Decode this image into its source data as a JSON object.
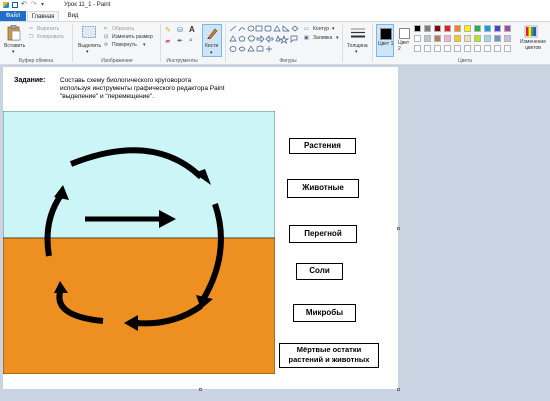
{
  "window": {
    "title": "Урок 11_1 - Paint"
  },
  "tabs": {
    "file": "Файл",
    "home": "Главная",
    "view": "Вид"
  },
  "clipboard": {
    "paste": "Вставить",
    "cut": "Вырезать",
    "copy": "Копировать",
    "label": "Буфер обмена"
  },
  "image": {
    "select": "Выделить",
    "crop": "Обрезать",
    "resize": "Изменить размер",
    "rotate": "Повернуть",
    "label": "Изображение"
  },
  "tools": {
    "label": "Инструменты",
    "brushes": "Кисти"
  },
  "shapes": {
    "outline": "Контур",
    "fill": "Заливка",
    "label": "Фигуры"
  },
  "size": {
    "label": "Толщина"
  },
  "colors": {
    "color1": "Цвет 1",
    "color2": "Цвет 2",
    "edit": "Изменение цветов",
    "label": "Цвета",
    "palette_row1": [
      "#000000",
      "#7f7f7f",
      "#880015",
      "#ed1c24",
      "#ff7f27",
      "#fff200",
      "#22b14c",
      "#00a2e8",
      "#3f48cc",
      "#a349a4"
    ],
    "palette_row2": [
      "#ffffff",
      "#c3c3c3",
      "#b97a57",
      "#ffaec9",
      "#ffc90e",
      "#efe4b0",
      "#b5e61d",
      "#99d9ea",
      "#7092be",
      "#c8bfe7"
    ]
  },
  "canvas": {
    "task_head": "Задание:",
    "task_line1": "Составь схему    биологического круговорота",
    "task_line2": "используя инструменты графического редактора Paint",
    "task_line3": "\"выделение\" и \"перемещение\".",
    "sky_color": "#ccf5f7",
    "ground_color": "#ee8f22",
    "labels": [
      "Растения",
      "Животные",
      "Перегной",
      "Соли",
      "Микробы"
    ],
    "label_last_1": "Мёртвые остатки",
    "label_last_2": "растений и животных"
  }
}
